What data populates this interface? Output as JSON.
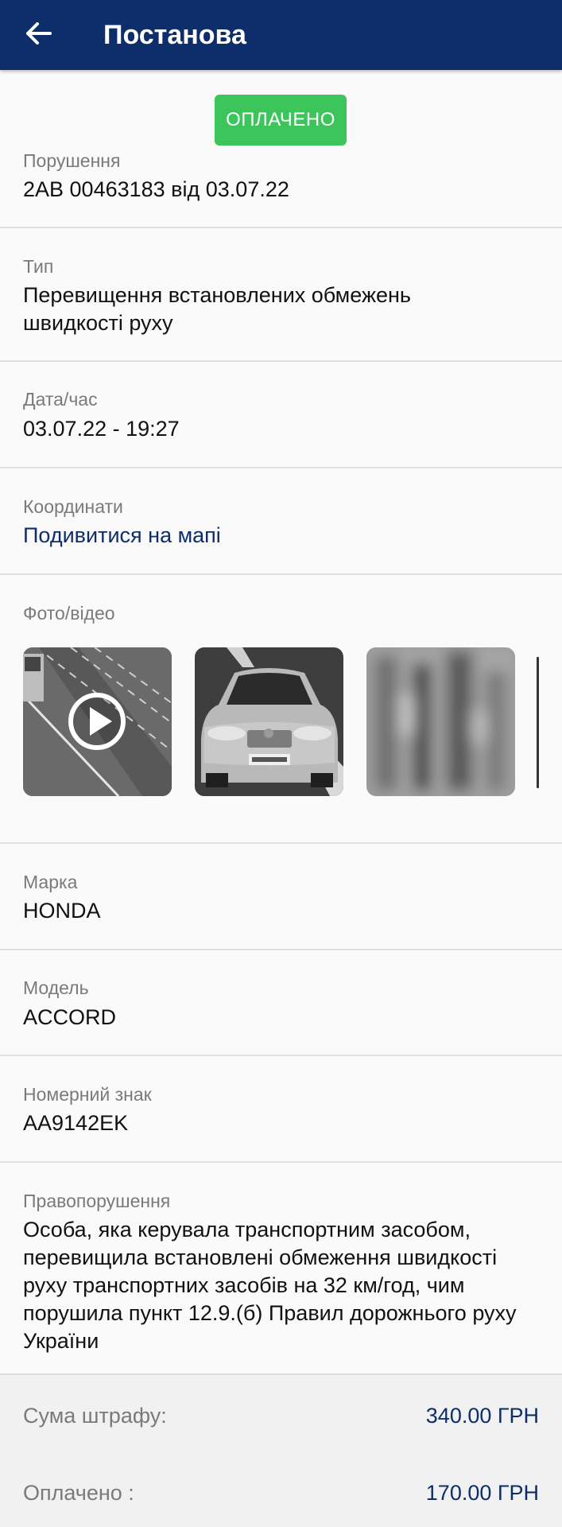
{
  "header": {
    "title": "Постанова",
    "back_icon": "arrow-left-icon",
    "background_color": "#0e2d6b"
  },
  "status_badge": {
    "label": "ОПЛАЧЕНО",
    "color": "#3cc55a"
  },
  "fields": {
    "violation": {
      "label": "Порушення",
      "value": "2АВ 00463183 від 03.07.22"
    },
    "type": {
      "label": "Тип",
      "value": "Перевищення встановлених обмежень швидкості руху"
    },
    "datetime": {
      "label": "Дата/час",
      "value": "03.07.22 - 19:27"
    },
    "coordinates": {
      "label": "Координати",
      "link": "Подивитися на мапі"
    },
    "media": {
      "label": "Фото/відео",
      "items": [
        "video-thumbnail",
        "car-photo",
        "plate-closeup-photo"
      ]
    },
    "brand": {
      "label": "Марка",
      "value": "HONDA"
    },
    "model": {
      "label": "Модель",
      "value": "ACCORD"
    },
    "plate": {
      "label": "Номерний знак",
      "value": "AA9142EK"
    },
    "offense": {
      "label": "Правопорушення",
      "value": "Особа, яка керувала транспортним засобом, перевищила встановлені обмеження швидкості руху транспортних засобів на 32 км/год, чим порушила пункт 12.9.(б) Правил дорожнього руху України"
    }
  },
  "summary": {
    "fine_label": "Сума штрафу:",
    "fine_value": "340.00 ГРН",
    "paid_label": "Оплачено :",
    "paid_value": "170.00 ГРН"
  }
}
